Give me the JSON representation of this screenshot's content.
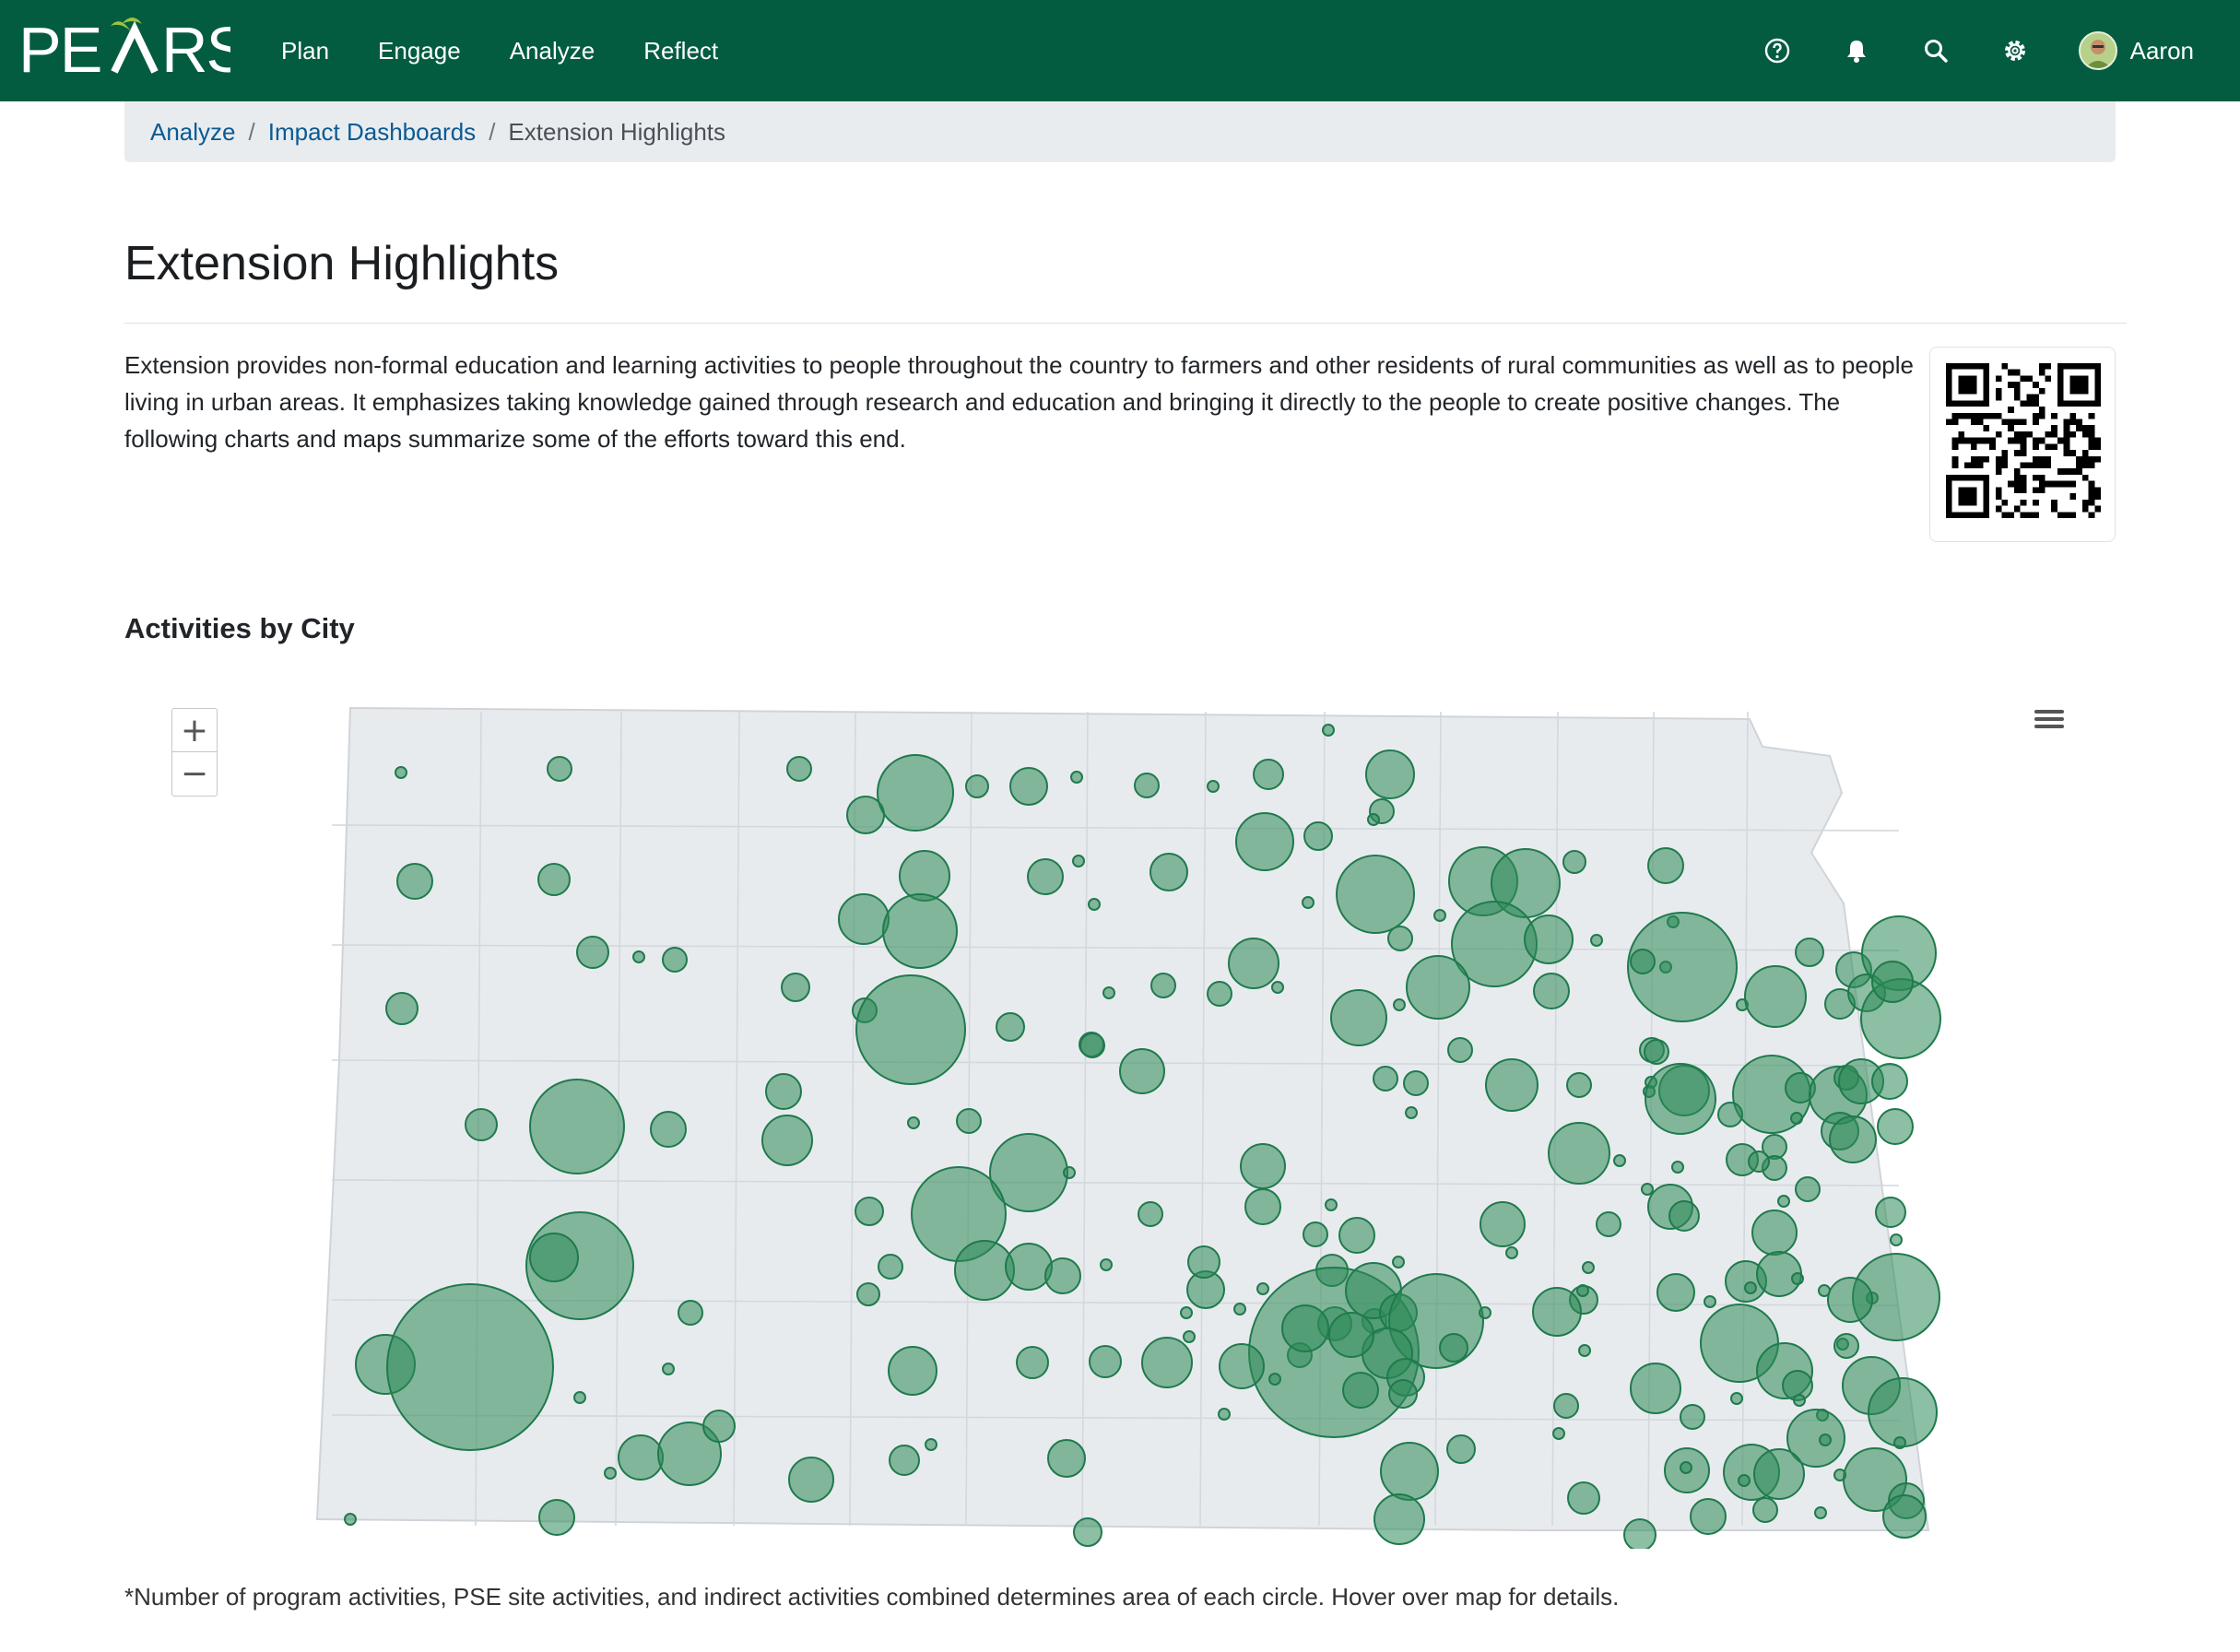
{
  "nav": {
    "logo_text": "PEARS",
    "links": [
      "Plan",
      "Engage",
      "Analyze",
      "Reflect"
    ],
    "icons": [
      "help-icon",
      "bell-icon",
      "search-icon",
      "gear-icon"
    ],
    "user_name": "Aaron",
    "bg_color": "#035c40"
  },
  "breadcrumb": {
    "items": [
      "Analyze",
      "Impact Dashboards"
    ],
    "current": "Extension Highlights",
    "separator": "/"
  },
  "page": {
    "title": "Extension Highlights",
    "intro": "Extension provides non-formal education and learning activities to people throughout the country  to farmers and other residents of rural communities as well as to people living in urban areas. It emphasizes taking knowledge gained through research and education and bringing it directly to the people to create positive changes. The following charts and maps summarize some of the efforts toward this end."
  },
  "map": {
    "title": "Activities by City",
    "zoom_in": "+",
    "zoom_out": "−",
    "bubble_color": "#2e8b57",
    "region_color": "#e8ebee"
  },
  "footnote": "*Number of program activities, PSE site activities, and indirect activities combined determines area of each circle. Hover over map for details."
}
